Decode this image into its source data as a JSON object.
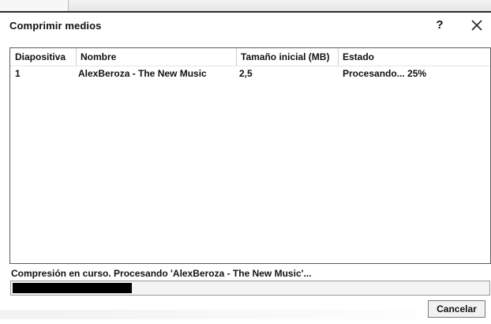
{
  "dialog": {
    "title": "Comprimir medios",
    "help_label": "?",
    "close_icon": "close-icon"
  },
  "table": {
    "columns": [
      "Diapositiva",
      "Nombre",
      "Tamaño inicial (MB)",
      "Estado"
    ],
    "rows": [
      {
        "slide": "1",
        "name": "AlexBeroza - The New Music",
        "size": "2,5",
        "status": "Procesando... 25%"
      }
    ]
  },
  "footer": {
    "status_text": "Compresión en curso. Procesando 'AlexBeroza - The New Music'...",
    "progress_fraction": 0.25,
    "cancel_label": "Cancelar"
  },
  "colors": {
    "progress_fill": "#000000",
    "border": "#5a5a5a"
  }
}
